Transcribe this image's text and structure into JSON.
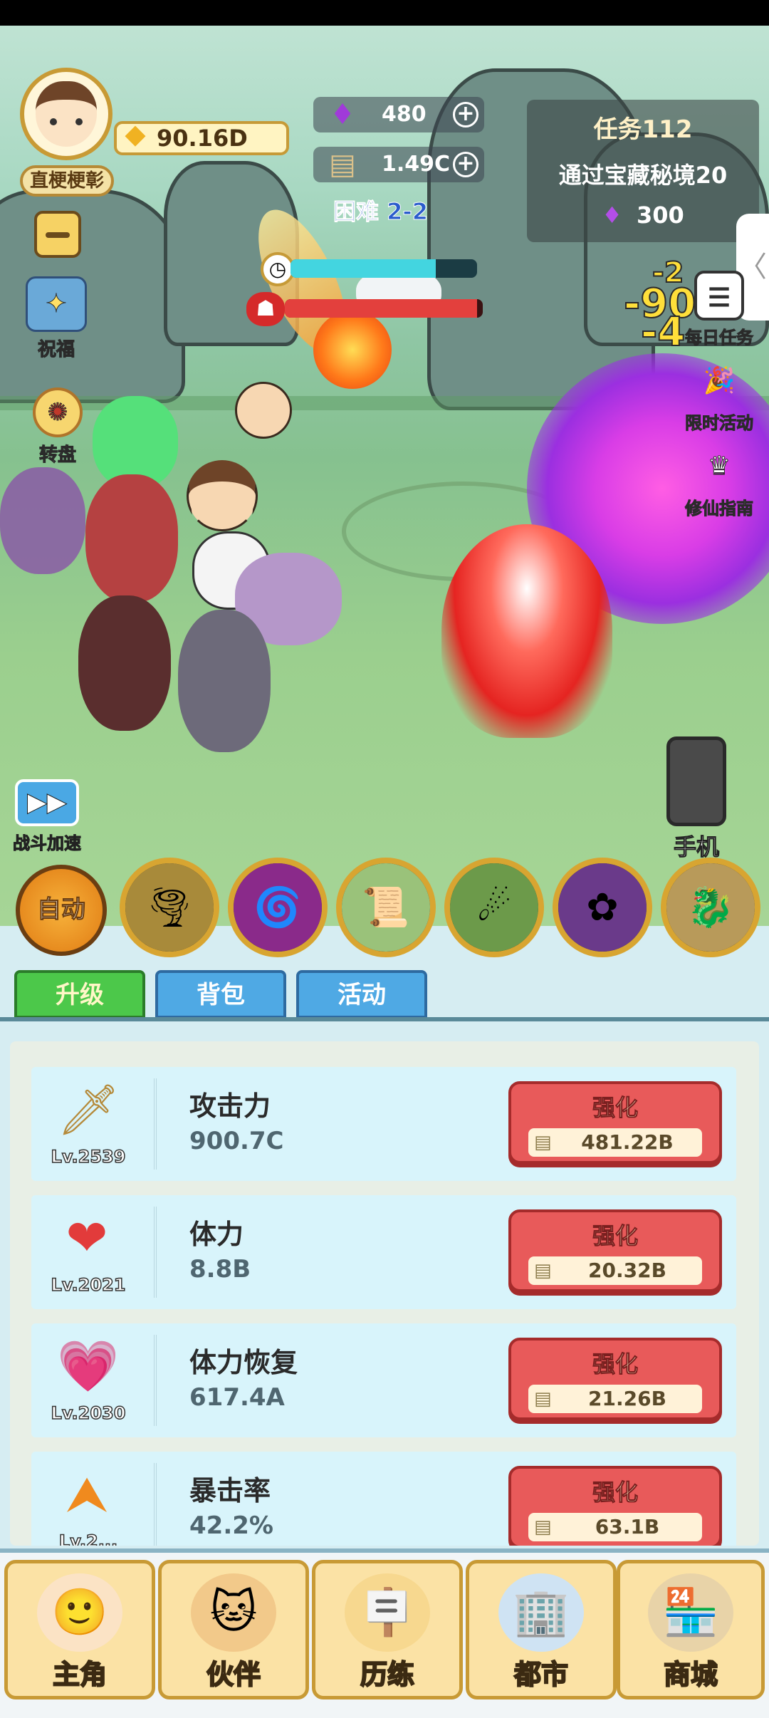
{
  "header": {
    "player_name": "直梗梗彰",
    "gold": "90.16D"
  },
  "resources": {
    "gems": "480",
    "cash": "1.49C",
    "stage": "困难 2-2"
  },
  "task": {
    "title": "任务112",
    "desc": "通过宝藏秘境20",
    "reward": "300"
  },
  "left_buttons": {
    "blessing": "祝福",
    "wheel": "转盘",
    "speed_up": "战斗加速"
  },
  "right_buttons": {
    "daily_task": "每日任务",
    "limited_event": "限时活动",
    "guide": "修仙指南",
    "phone": "手机"
  },
  "battle": {
    "time_bar_fill": 0.78,
    "boss_hp_fill": 0.97,
    "damage_numbers": [
      "-90",
      "-2",
      "-4"
    ]
  },
  "skills": {
    "auto_label": "自动",
    "items": [
      {
        "icon": "tornado-skill-icon",
        "glyph": "🌪"
      },
      {
        "icon": "vortex-skill-icon",
        "glyph": "🌀"
      },
      {
        "icon": "talisman-skill-icon",
        "glyph": "📜"
      },
      {
        "icon": "comet-skill-icon",
        "glyph": "☄"
      },
      {
        "icon": "fan-skill-icon",
        "glyph": "✿"
      },
      {
        "icon": "beast-skill-icon",
        "glyph": "🐉"
      }
    ]
  },
  "tabs": [
    "升级",
    "背包",
    "活动"
  ],
  "upgrade_button_label": "强化",
  "upgrades": [
    {
      "name": "攻击力",
      "value": "900.7C",
      "level": "Lv.2539",
      "cost": "481.22B",
      "icon": "sword-icon",
      "glyph": "🗡"
    },
    {
      "name": "体力",
      "value": "8.8B",
      "level": "Lv.2021",
      "cost": "20.32B",
      "icon": "heart-icon",
      "glyph": "❤"
    },
    {
      "name": "体力恢复",
      "value": "617.4A",
      "level": "Lv.2030",
      "cost": "21.26B",
      "icon": "heart-regen-icon",
      "glyph": "💗"
    },
    {
      "name": "暴击率",
      "value": "42.2%",
      "level": "Lv.2...",
      "cost": "63.1B",
      "icon": "crit-arrow-icon",
      "glyph": "⮝"
    }
  ],
  "nav": [
    {
      "label": "主角",
      "icon": "hero-icon",
      "glyph": "🙂"
    },
    {
      "label": "伙伴",
      "icon": "cat-icon",
      "glyph": "🐱"
    },
    {
      "label": "历练",
      "icon": "training-sign-icon",
      "glyph": "🪧"
    },
    {
      "label": "都市",
      "icon": "city-building-icon",
      "glyph": "🏢"
    },
    {
      "label": "商城",
      "icon": "shop-stall-icon",
      "glyph": "🏪"
    }
  ],
  "colors": {
    "accent_gold": "#c89a35",
    "upgrade_red": "#e85a5a",
    "tab_green": "#4cc84a",
    "tab_blue": "#4fa9e4"
  }
}
